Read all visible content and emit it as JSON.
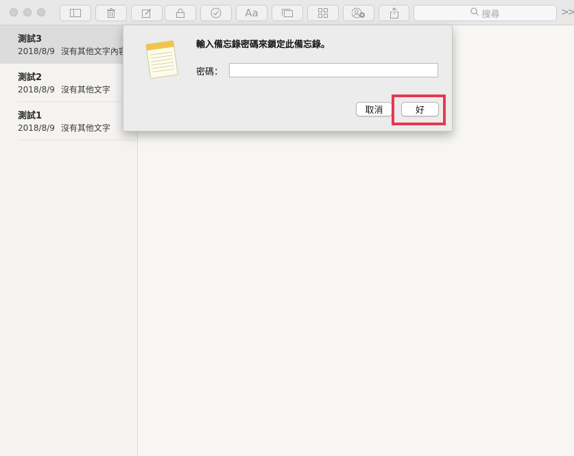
{
  "toolbar": {
    "buttons": [
      {
        "icon": "sidebar-toggle-icon"
      },
      {
        "icon": "trash-icon"
      },
      {
        "icon": "compose-icon"
      },
      {
        "icon": "lock-icon"
      },
      {
        "icon": "checklist-icon"
      },
      {
        "icon": "format-icon",
        "label": "Aa"
      },
      {
        "icon": "gallery-icon"
      },
      {
        "icon": "table-icon"
      },
      {
        "icon": "add-people-icon"
      },
      {
        "icon": "share-icon"
      }
    ],
    "search_placeholder": "搜尋",
    "overflow_label": ">>"
  },
  "sidebar": {
    "notes": [
      {
        "title": "測試3",
        "date": "2018/8/9",
        "snippet": "沒有其他文字內容",
        "selected": true
      },
      {
        "title": "測試2",
        "date": "2018/8/9",
        "snippet": "沒有其他文字",
        "selected": false
      },
      {
        "title": "測試1",
        "date": "2018/8/9",
        "snippet": "沒有其他文字",
        "selected": false
      }
    ]
  },
  "dialog": {
    "message": "輸入備忘錄密碼來鎖定此備忘錄。",
    "password_label": "密碼：",
    "password_value": "",
    "cancel_label": "取消",
    "ok_label": "好"
  },
  "colors": {
    "highlight": "#e8384f"
  }
}
